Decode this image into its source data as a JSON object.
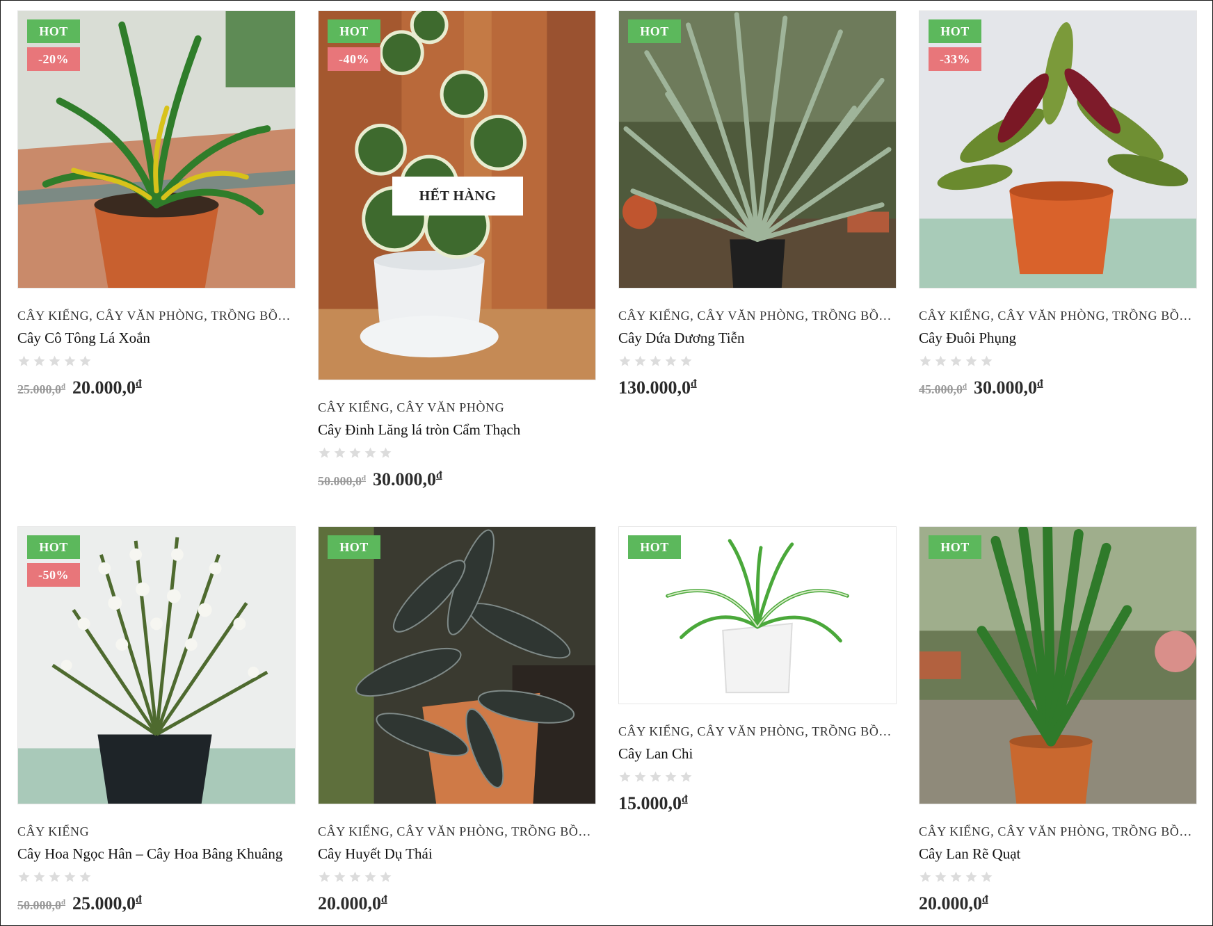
{
  "products": [
    {
      "title": "Cây Cô Tông Lá Xoắn",
      "categories": "Cây kiểng, Cây văn phòng, Trồng bồn …",
      "hot_label": "HOT",
      "sale_label": "-20%",
      "price_old": "25.000,0",
      "price_new": "20.000,0",
      "currency": "đ",
      "rating_stars": 5
    },
    {
      "title": "Cây Đinh Lăng lá tròn Cẩm Thạch",
      "categories": "Cây kiểng, Cây văn phòng",
      "hot_label": "HOT",
      "sale_label": "-40%",
      "out_of_stock_label": "HẾT HÀNG",
      "price_old": "50.000,0",
      "price_new": "30.000,0",
      "currency": "đ",
      "rating_stars": 5
    },
    {
      "title": "Cây Dứa Dương Tiễn",
      "categories": "Cây kiểng, Cây văn phòng, Trồng bồn …",
      "hot_label": "HOT",
      "price_new": "130.000,0",
      "currency": "đ",
      "rating_stars": 5
    },
    {
      "title": "Cây Đuôi Phụng",
      "categories": "Cây kiểng, Cây văn phòng, Trồng bồn …",
      "hot_label": "HOT",
      "sale_label": "-33%",
      "price_old": "45.000,0",
      "price_new": "30.000,0",
      "currency": "đ",
      "rating_stars": 5
    },
    {
      "title": "Cây Hoa Ngọc Hân – Cây Hoa Bâng Khuâng",
      "categories": "Cây kiểng",
      "hot_label": "HOT",
      "sale_label": "-50%",
      "price_old": "50.000,0",
      "price_new": "25.000,0",
      "currency": "đ",
      "rating_stars": 5
    },
    {
      "title": "Cây Huyết Dụ Thái",
      "categories": "Cây kiểng, Cây văn phòng, Trồng bồn …",
      "hot_label": "HOT",
      "price_new": "20.000,0",
      "currency": "đ",
      "rating_stars": 5
    },
    {
      "title": "Cây Lan Chi",
      "categories": "Cây kiểng, Cây văn phòng, Trồng bồn …",
      "hot_label": "HOT",
      "price_new": "15.000,0",
      "currency": "đ",
      "rating_stars": 5
    },
    {
      "title": "Cây Lan Rẽ Quạt",
      "categories": "Cây kiểng, Cây văn phòng, Trồng bồn …",
      "hot_label": "HOT",
      "price_new": "20.000,0",
      "currency": "đ",
      "rating_stars": 5
    }
  ],
  "colors": {
    "hot": "#5cb85c",
    "sale": "#e8767a",
    "star_empty": "#dcdcdc"
  }
}
